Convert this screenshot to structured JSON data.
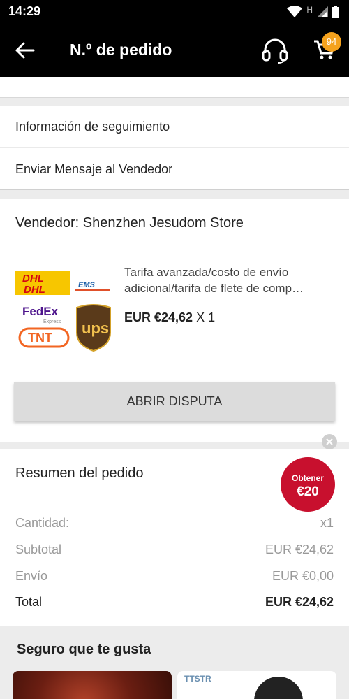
{
  "status_bar": {
    "time": "14:29",
    "network": "H"
  },
  "app_bar": {
    "title": "N.º de pedido",
    "cart_count": "94"
  },
  "links": {
    "tracking": "Información de seguimiento",
    "message_seller": "Enviar Mensaje al Vendedor"
  },
  "seller": {
    "label": "Vendedor: Shenzhen Jesudom Store"
  },
  "product": {
    "title_line1": "Tarifa avanzada/costo de envío",
    "title_line2": "adicional/tarifa de flete de comp…",
    "price": "EUR €24,62",
    "quantity": "X 1",
    "logos": {
      "dhl": "DHL",
      "ems": "EMS",
      "fedex": "FedEx",
      "fedex_sub": "Express",
      "tnt": "TNT",
      "ups": "ups"
    }
  },
  "dispute": {
    "label": "ABRIR DISPUTA"
  },
  "summary": {
    "title": "Resumen del pedido",
    "promo_line1": "Obtener",
    "promo_line2": "€20",
    "rows": [
      {
        "label": "Cantidad:",
        "value": "x1"
      },
      {
        "label": "Subtotal",
        "value": "EUR €24,62"
      },
      {
        "label": "Envío",
        "value": "EUR €0,00"
      },
      {
        "label": "Total",
        "value": "EUR €24,62"
      }
    ]
  },
  "recommendations": {
    "title": "Seguro que te gusta",
    "card2_brand": "TTSTR"
  },
  "colors": {
    "bar": "#000000",
    "badge": "#f5a21d",
    "promo": "#c8102e",
    "dispute": "#dcdcdc"
  }
}
